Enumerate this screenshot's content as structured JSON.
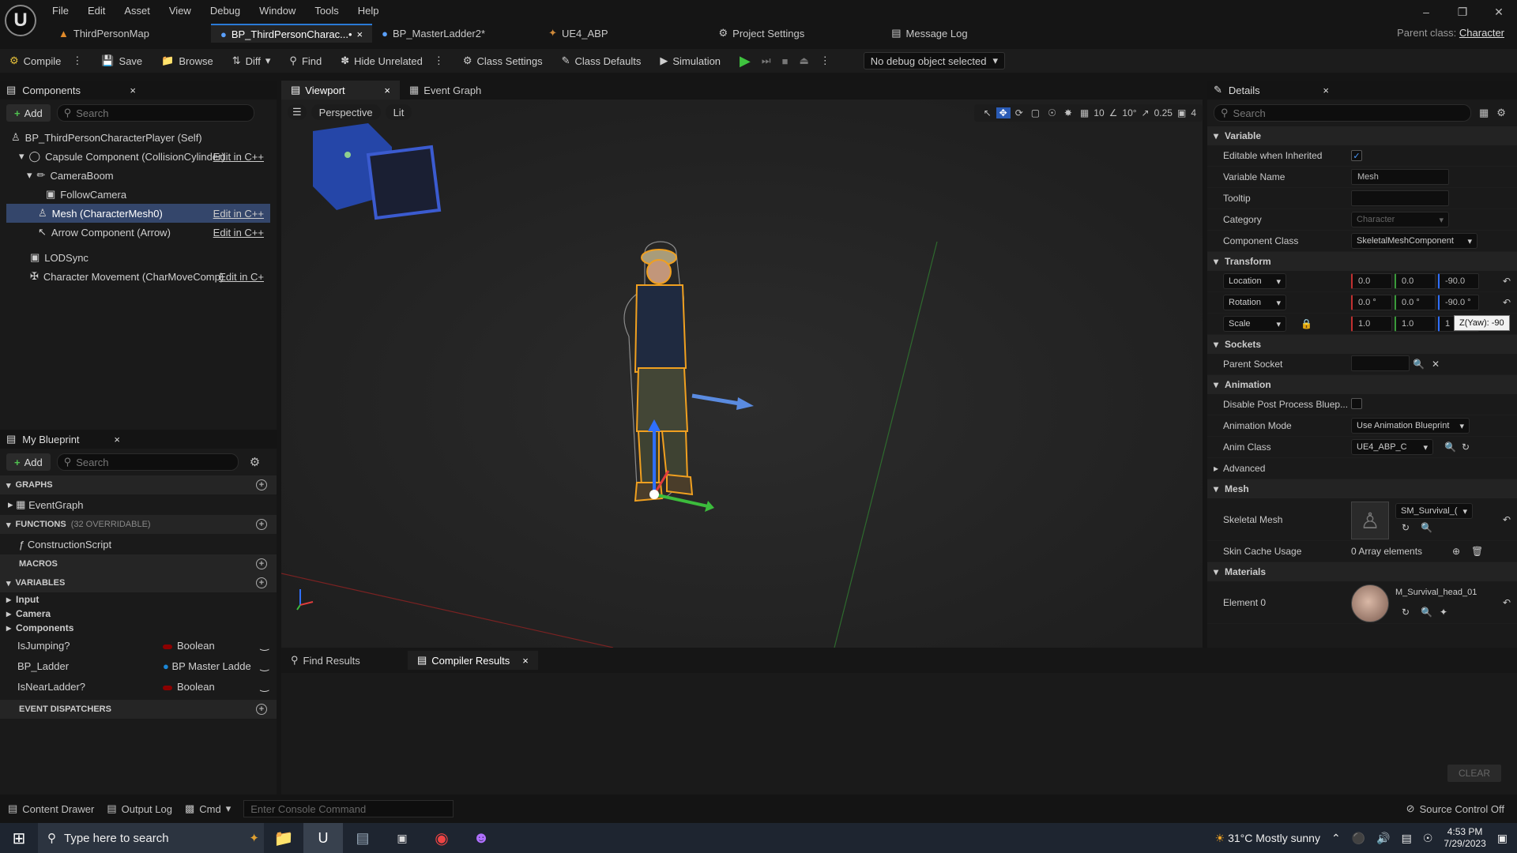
{
  "menu": [
    "File",
    "Edit",
    "Asset",
    "View",
    "Debug",
    "Window",
    "Tools",
    "Help"
  ],
  "tabs": [
    "ThirdPersonMap",
    "BP_ThirdPersonCharac...•",
    "BP_MasterLadder2*",
    "UE4_ABP",
    "Project Settings",
    "Message Log"
  ],
  "parent_class": {
    "label": "Parent class:",
    "value": "Character"
  },
  "toolbar": {
    "compile": "Compile",
    "save": "Save",
    "browse": "Browse",
    "diff": "Diff",
    "find": "Find",
    "hide_unrelated": "Hide Unrelated",
    "class_settings": "Class Settings",
    "class_defaults": "Class Defaults",
    "simulation": "Simulation",
    "debug_select": "No debug object selected"
  },
  "components": {
    "title": "Components",
    "add": "Add",
    "search_placeholder": "Search",
    "items": [
      {
        "label": "BP_ThirdPersonCharacterPlayer (Self)",
        "edit": ""
      },
      {
        "label": "Capsule Component (CollisionCylinder)",
        "edit": "Edit in C++"
      },
      {
        "label": "CameraBoom",
        "edit": ""
      },
      {
        "label": "FollowCamera",
        "edit": ""
      },
      {
        "label": "Mesh (CharacterMesh0)",
        "edit": "Edit in C++"
      },
      {
        "label": "Arrow Component (Arrow)",
        "edit": "Edit in C++"
      },
      {
        "label": "LODSync",
        "edit": ""
      },
      {
        "label": "Character Movement (CharMoveComp)",
        "edit": "Edit in C+"
      }
    ]
  },
  "myblueprint": {
    "title": "My Blueprint",
    "add": "Add",
    "search_placeholder": "Search",
    "graphs": "GRAPHS",
    "event_graph": "EventGraph",
    "functions": "FUNCTIONS",
    "functions_note": "(32 OVERRIDABLE)",
    "construction": "ConstructionScript",
    "macros": "MACROS",
    "variables": "VARIABLES",
    "categories": [
      "Input",
      "Camera",
      "Components"
    ],
    "vars": [
      {
        "name": "IsJumping?",
        "type": "Boolean",
        "color": "#8c0000"
      },
      {
        "name": "BP_Ladder",
        "type": "BP Master Ladde",
        "color": "#1b87d6"
      },
      {
        "name": "IsNearLadder?",
        "type": "Boolean",
        "color": "#8c0000"
      }
    ],
    "dispatchers": "EVENT DISPATCHERS"
  },
  "viewport": {
    "tab": "Viewport",
    "event_graph": "Event Graph",
    "perspective": "Perspective",
    "lit": "Lit",
    "grid": "10",
    "angle": "10°",
    "scale": "0.25",
    "cam": "4"
  },
  "details": {
    "title": "Details",
    "search_placeholder": "Search",
    "variable_section": "Variable",
    "editable_label": "Editable when Inherited",
    "varname_label": "Variable Name",
    "varname": "Mesh",
    "tooltip_label": "Tooltip",
    "category_label": "Category",
    "category": "Character",
    "compclass_label": "Component Class",
    "compclass": "SkeletalMeshComponent",
    "transform_section": "Transform",
    "location": "Location",
    "loc": [
      "0.0",
      "0.0",
      "-90.0"
    ],
    "rotation": "Rotation",
    "rot": [
      "0.0 °",
      "0.0 °",
      "-90.0 °"
    ],
    "scale": "Scale",
    "scl": [
      "1.0",
      "1.0",
      "1"
    ],
    "tooltip_pop": "Z(Yaw): -90",
    "sockets_section": "Sockets",
    "parent_socket": "Parent Socket",
    "animation_section": "Animation",
    "disable_pp": "Disable Post Process Bluep...",
    "anim_mode_label": "Animation Mode",
    "anim_mode": "Use Animation Blueprint",
    "anim_class_label": "Anim Class",
    "anim_class": "UE4_ABP_C",
    "advanced": "Advanced",
    "mesh_section": "Mesh",
    "skeletal_mesh_label": "Skeletal Mesh",
    "skeletal_mesh": "SM_Survival_(",
    "skin_cache_label": "Skin Cache Usage",
    "skin_cache": "0 Array elements",
    "materials_section": "Materials",
    "element0_label": "Element 0",
    "element0": "M_Survival_head_01"
  },
  "bottom": {
    "find": "Find Results",
    "compiler": "Compiler Results",
    "clear": "CLEAR"
  },
  "status": {
    "content_drawer": "Content Drawer",
    "output_log": "Output Log",
    "cmd": "Cmd",
    "console_placeholder": "Enter Console Command",
    "source_control": "Source Control Off"
  },
  "taskbar": {
    "search": "Type here to search",
    "weather": "31°C  Mostly sunny",
    "time": "4:53 PM",
    "date": "7/29/2023"
  },
  "colors": {
    "accent": "#2a7ad6",
    "selection": "#34466b",
    "play": "#3fc33f",
    "outline": "#f0a020"
  }
}
